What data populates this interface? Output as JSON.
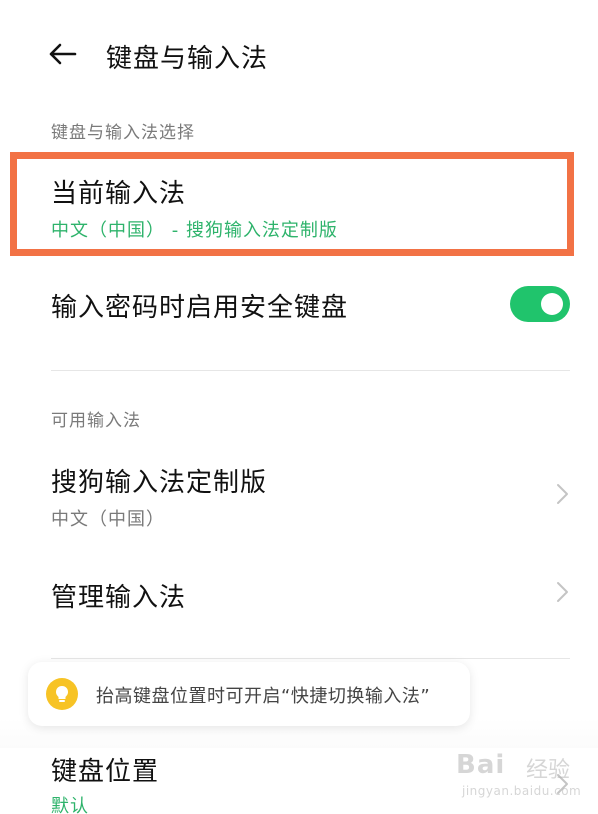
{
  "header": {
    "back_icon": "arrow-left-icon",
    "title": "键盘与输入法"
  },
  "section_selection": {
    "label": "键盘与输入法选择",
    "current_ime": {
      "title": "当前输入法",
      "value": "中文（中国） - 搜狗输入法定制版"
    },
    "secure_keyboard": {
      "title": "输入密码时启用安全键盘",
      "enabled": true
    }
  },
  "section_available": {
    "label": "可用输入法",
    "items": [
      {
        "title": "搜狗输入法定制版",
        "sub": "中文（中国）"
      },
      {
        "title": "管理输入法"
      }
    ]
  },
  "tip": {
    "icon": "lightbulb-icon",
    "text": "抬高键盘位置时可开启“快捷切换输入法”"
  },
  "keyboard_position": {
    "title": "键盘位置",
    "value": "默认"
  },
  "watermark": {
    "logo": "Bai",
    "cn": "经验",
    "url": "jingyan.baidu.com"
  },
  "colors": {
    "accent_green": "#2eb36b",
    "toggle_green": "#20c46c",
    "highlight_orange": "#f27245",
    "tip_yellow": "#f7c325"
  }
}
